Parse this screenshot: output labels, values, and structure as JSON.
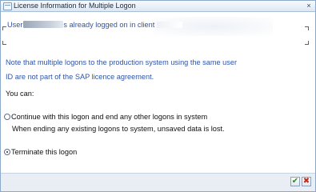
{
  "window": {
    "title": "License Information for Multiple Logon",
    "close_glyph": "×"
  },
  "message": {
    "prefix": "User",
    "suffix": "s already logged on in client"
  },
  "note": {
    "line1": "Note that multiple logons to the production system using the same user",
    "line2": "ID are not part of the SAP licence agreement."
  },
  "prompt": "You can:",
  "options": [
    {
      "label": "Continue with this logon and end any other logons in system",
      "selected": false
    },
    {
      "label": "Terminate this logon",
      "selected": true
    }
  ],
  "option_note": "When ending any existing logons to system, unsaved data is lost.",
  "buttons": {
    "ok_glyph": "✔",
    "cancel_glyph": "✖"
  },
  "colors": {
    "message_text": "#2f54a8",
    "ok_green": "#2a8a1e",
    "cancel_red": "#c42a1a"
  }
}
